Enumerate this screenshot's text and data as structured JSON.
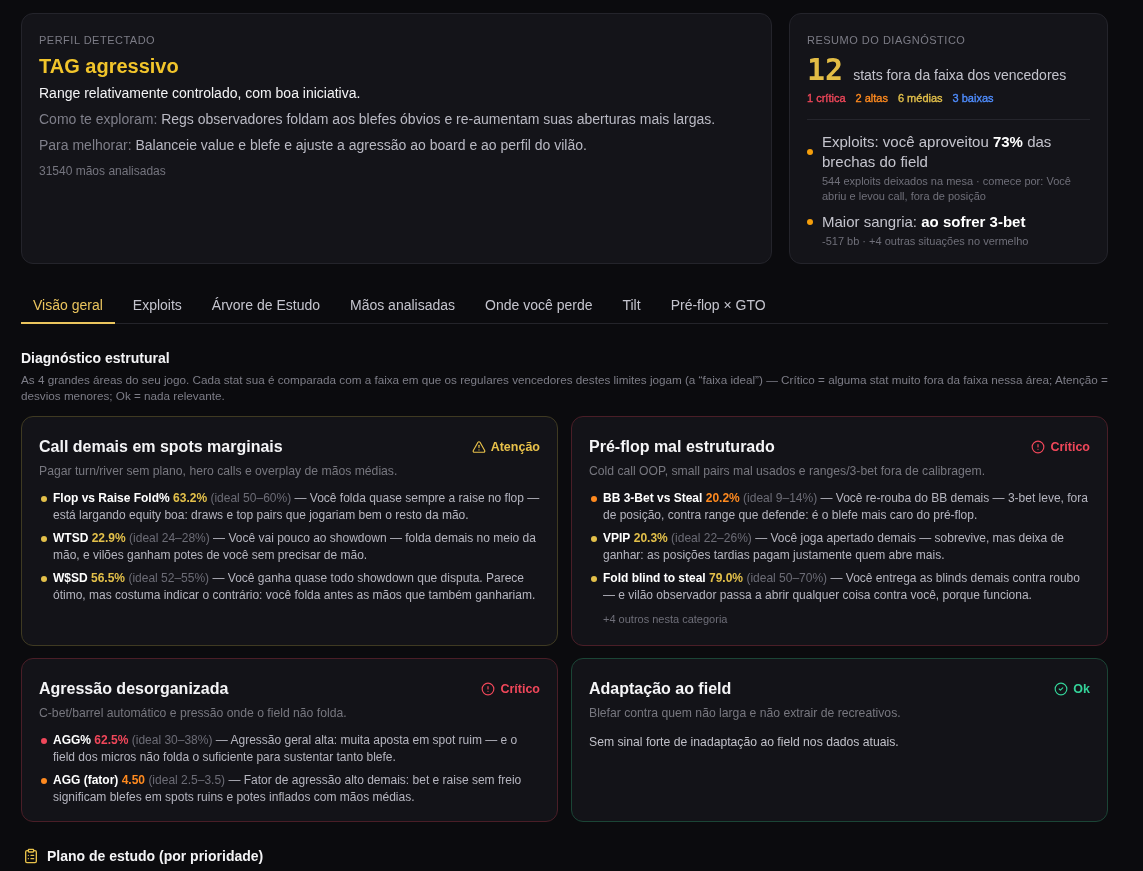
{
  "profile": {
    "label": "PERFIL DETECTADO",
    "title": "TAG agressivo",
    "summary": "Range relativamente controlado, com boa iniciativa.",
    "details": [
      {
        "label": "Como te exploram:",
        "text": "Regs observadores foldam aos blefes óbvios e re-aumentam suas aberturas mais largas."
      },
      {
        "label": "Para melhorar:",
        "text": "Balanceie value e blefe e ajuste a agressão ao board e ao perfil do vilão."
      }
    ],
    "hands": "31540 mãos analisadas"
  },
  "diagnosis_summary": {
    "label": "RESUMO DO DIAGNÓSTICO",
    "count": "12",
    "count_caption": "stats fora da faixa dos vencedores",
    "severities": [
      {
        "text": "1 crítica",
        "color": "#f0475a"
      },
      {
        "text": "2 altas",
        "color": "#ff8a1f"
      },
      {
        "text": "6 médias",
        "color": "#e3c04a"
      },
      {
        "text": "3 baixas",
        "color": "#4f8dff"
      }
    ],
    "highlights": [
      {
        "text": "Exploits: você aproveitou **73%** das brechas do field",
        "note": "544 exploits deixados na mesa · comece por: Você abriu e levou call, fora de posição",
        "color": "#f59e0b"
      },
      {
        "text": "Maior sangria: **ao sofrer 3-bet**",
        "note": "-517 bb · +4 outras situações no vermelho",
        "color": "#f59e0b"
      }
    ]
  },
  "tabs": [
    {
      "label": "Visão geral",
      "selected": true
    },
    {
      "label": "Exploits",
      "selected": false
    },
    {
      "label": "Árvore de Estudo",
      "selected": false
    },
    {
      "label": "Mãos analisadas",
      "selected": false
    },
    {
      "label": "Onde você perde",
      "selected": false
    },
    {
      "label": "Tilt",
      "selected": false
    },
    {
      "label": "Pré-flop × GTO",
      "selected": false
    }
  ],
  "section": {
    "title": "Diagnóstico estrutural",
    "description": "As 4 grandes áreas do seu jogo. Cada stat sua é comparada com a faixa em que os regulares vencedores destes limites jogam (a “faixa ideal”) — Crítico = alguma stat muito fora da faixa nessa área; Atenção = desvios menores; Ok = nada relevante."
  },
  "areas": [
    {
      "title": "Call demais em spots marginais",
      "kind": "attention",
      "status_label": "Atenção",
      "subtitle": "Pagar turn/river sem plano, hero calls e overplay de mãos médias.",
      "stats": [
        {
          "name": "Flop vs Raise Fold%",
          "value": "63.2%",
          "ideal": "(ideal 50–60%)",
          "text": "— Você folda quase sempre a raise no flop — está largando equity boa: draws e top pairs que jogariam bem o resto da mão.",
          "color": "#e3c04a"
        },
        {
          "name": "WTSD",
          "value": "22.9%",
          "ideal": "(ideal 24–28%)",
          "text": "— Você vai pouco ao showdown — folda demais no meio da mão, e vilões ganham potes de você sem precisar de mão.",
          "color": "#e3c04a"
        },
        {
          "name": "W$SD",
          "value": "56.5%",
          "ideal": "(ideal 52–55%)",
          "text": "— Você ganha quase todo showdown que disputa. Parece ótimo, mas costuma indicar o contrário: você folda antes as mãos que também ganhariam.",
          "color": "#e3c04a"
        }
      ]
    },
    {
      "title": "Pré-flop mal estruturado",
      "kind": "critical",
      "status_label": "Crítico",
      "subtitle": "Cold call OOP, small pairs mal usados e ranges/3-bet fora de calibragem.",
      "stats": [
        {
          "name": "BB 3-Bet vs Steal",
          "value": "20.2%",
          "ideal": "(ideal 9–14%)",
          "text": "— Você re-rouba do BB demais — 3-bet leve, fora de posição, contra range que defende: é o blefe mais caro do pré-flop.",
          "color": "#ff8a1f"
        },
        {
          "name": "VPIP",
          "value": "20.3%",
          "ideal": "(ideal 22–26%)",
          "text": "— Você joga apertado demais — sobrevive, mas deixa de ganhar: as posições tardias pagam justamente quem abre mais.",
          "color": "#e3c04a"
        },
        {
          "name": "Fold blind to steal",
          "value": "79.0%",
          "ideal": "(ideal 50–70%)",
          "text": "— Você entrega as blinds demais contra roubo — e vilão observador passa a abrir qualquer coisa contra você, porque funciona.",
          "color": "#e3c04a"
        }
      ],
      "more": "+4 outros nesta categoria"
    },
    {
      "title": "Agressão desorganizada",
      "kind": "critical",
      "status_label": "Crítico",
      "subtitle": "C-bet/barrel automático e pressão onde o field não folda.",
      "stats": [
        {
          "name": "AGG%",
          "value": "62.5%",
          "ideal": "(ideal 30–38%)",
          "text": "— Agressão geral alta: muita aposta em spot ruim — e o field dos micros não folda o suficiente para sustentar tanto blefe.",
          "color": "#f0475a"
        },
        {
          "name": "AGG (fator)",
          "value": "4.50",
          "ideal": "(ideal 2.5–3.5)",
          "text": "— Fator de agressão alto demais: bet e raise sem freio significam blefes em spots ruins e potes inflados com mãos médias.",
          "color": "#ff8a1f"
        }
      ]
    },
    {
      "title": "Adaptação ao field",
      "kind": "ok",
      "status_label": "Ok",
      "subtitle": "Blefar contra quem não larga e não extrair de recreativos.",
      "message": "Sem sinal forte de inadaptação ao field nos dados atuais."
    }
  ],
  "study_plan": {
    "title": "Plano de estudo (por prioridade)"
  }
}
